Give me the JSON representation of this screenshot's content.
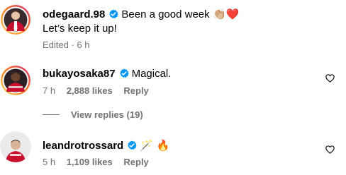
{
  "comments": [
    {
      "username": "odegaard.98",
      "text_line1": "Been a good week",
      "emoji_line1": "👏🏼❤️",
      "text_line2": "Let’s keep it up!",
      "time": "Edited · 6 h",
      "avatar_icon": "player-jersey-avatar",
      "verified_icon": "verified-badge-icon"
    },
    {
      "username": "bukayosaka87",
      "text": "Magical.",
      "time": "7 h",
      "likes": "2,888 likes",
      "reply": "Reply",
      "view_replies": "View replies (19)",
      "avatar_icon": "player-avatar",
      "verified_icon": "verified-badge-icon"
    },
    {
      "username": "leandrotrossard",
      "emoji": "🪄 🔥",
      "time": "5 h",
      "likes": "1,109 likes",
      "reply": "Reply",
      "avatar_icon": "player-avatar",
      "verified_icon": "verified-badge-icon"
    }
  ],
  "colors": {
    "verified": "#0095f6",
    "secondary_text": "#737373",
    "story_ring_start": "#feda75",
    "story_ring_end": "#d62976",
    "jersey_red": "#c8102e"
  }
}
